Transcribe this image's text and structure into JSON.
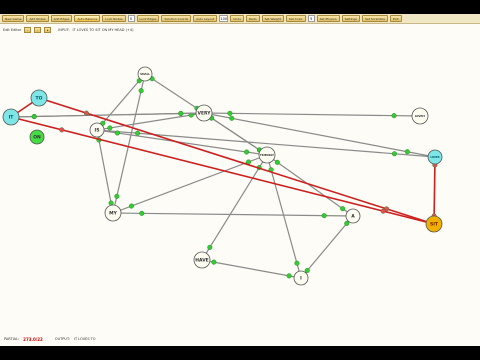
{
  "toolbar": {
    "buttons": [
      "New Game",
      "Add Nodes",
      "Add Edges",
      "Auto Balance",
      "Lock Nodes"
    ],
    "field1_value": "0",
    "buttons2": [
      "Lock Edges",
      "Solution Coords",
      "Auto Layout"
    ],
    "field2_value": "100",
    "buttons3": [
      "Undo",
      "Redo",
      "Set Weight",
      "Set Color"
    ],
    "field3_value": "5",
    "buttons4": [
      "Set Physics",
      "Settings",
      "Set Scramble",
      "Exit"
    ]
  },
  "row2": {
    "label": "Edit Editor",
    "input_label": "INPUT:",
    "input_text": "IT LOVES TO SIT ON MY HEAD   (+4)"
  },
  "nodes": [
    {
      "id": "to",
      "label": "TO"
    },
    {
      "id": "it",
      "label": "IT"
    },
    {
      "id": "on",
      "label": "ON"
    },
    {
      "id": "small",
      "label": "SMALL"
    },
    {
      "id": "very",
      "label": "VERY"
    },
    {
      "id": "is",
      "label": "IS"
    },
    {
      "id": "lovely",
      "label": "LOVELY"
    },
    {
      "id": "loves",
      "label": "LOVES"
    },
    {
      "id": "friendly",
      "label": "FRIENDLY"
    },
    {
      "id": "my",
      "label": "MY"
    },
    {
      "id": "a",
      "label": "A"
    },
    {
      "id": "sit",
      "label": "SIT"
    },
    {
      "id": "have",
      "label": "HAVE"
    },
    {
      "id": "i",
      "label": "I"
    }
  ],
  "status": {
    "left_label": "PARTIAL:",
    "score": "273.0/22",
    "output_label": "OUTPUT:",
    "output_text": "IT LOVES TO"
  },
  "colors": {
    "path_edge": "#cc2020",
    "edge": "#8a8a8a",
    "dot": "#33cc33",
    "cyan_node": "#7ee6e6",
    "green_node": "#44dd44",
    "gold_node": "#f0b000",
    "plain_node": "#fdfcf0"
  }
}
